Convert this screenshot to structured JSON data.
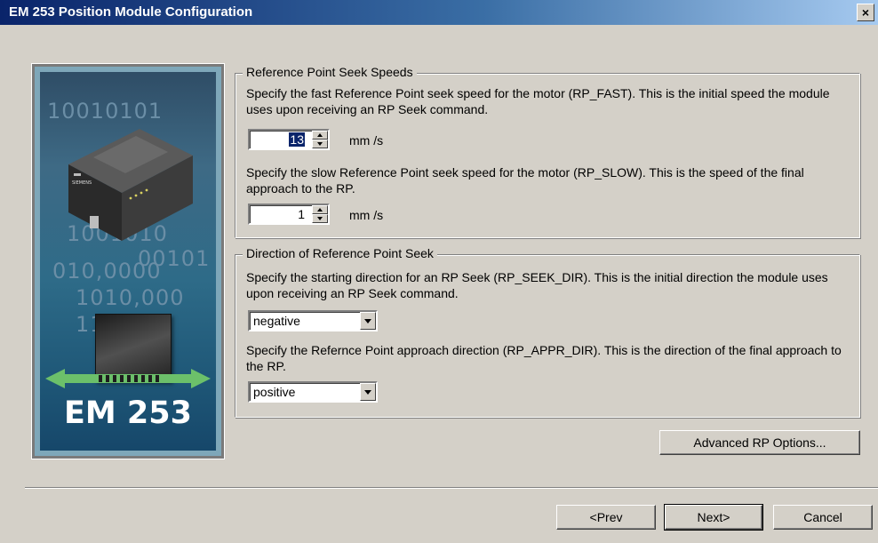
{
  "window": {
    "title": "EM 253 Position Module Configuration",
    "close_label": "×"
  },
  "banner": {
    "caption": "EM 253",
    "binary_rows": [
      "10010101",
      "1001010",
      "00101",
      "010,0000",
      "1010,000",
      "1101"
    ],
    "brand_label": "SIEMENS"
  },
  "seek_speeds": {
    "legend": "Reference Point Seek Speeds",
    "fast_desc": "Specify the fast Reference Point seek speed for the motor (RP_FAST).  This is the initial speed the module uses upon receiving an RP Seek command.",
    "fast_value": "13",
    "fast_unit": "mm  /s",
    "slow_desc": "Specify the slow Reference Point seek speed for the motor (RP_SLOW).  This is the speed of the final approach to the RP.",
    "slow_value": "1",
    "slow_unit": "mm  /s"
  },
  "seek_direction": {
    "legend": "Direction of Reference Point Seek",
    "start_desc": "Specify the starting direction for an RP Seek (RP_SEEK_DIR).  This is the initial direction the module uses upon receiving an RP Seek command.",
    "start_value": "negative",
    "approach_desc": "Specify the Refernce Point approach direction (RP_APPR_DIR).  This is the direction of the final approach to the RP.",
    "approach_value": "positive"
  },
  "buttons": {
    "advanced": "Advanced RP Options...",
    "prev": "<Prev",
    "next": "Next>",
    "cancel": "Cancel"
  }
}
